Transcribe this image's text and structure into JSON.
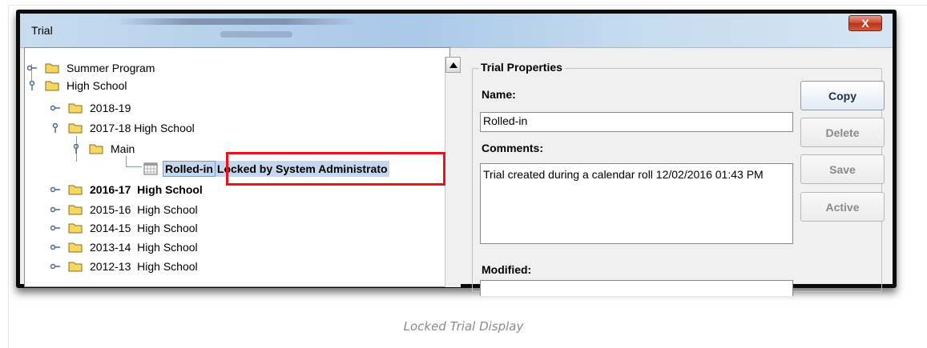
{
  "window": {
    "title": "Trial",
    "close_label": "X"
  },
  "tree": {
    "items": [
      {
        "label": "Summer Program",
        "level": 0,
        "expanded": false
      },
      {
        "label": "High School",
        "level": 0,
        "expanded": true
      },
      {
        "label": "2018-19",
        "level": 1,
        "expanded": false
      },
      {
        "label": "2017-18 High School",
        "level": 1,
        "expanded": true
      },
      {
        "label": "Main",
        "level": 2,
        "expanded": true
      },
      {
        "label": "2016-17  High School",
        "level": 1,
        "expanded": false,
        "bold": true
      },
      {
        "label": "2015-16  High School",
        "level": 1,
        "expanded": false
      },
      {
        "label": "2014-15  High School",
        "level": 1,
        "expanded": false
      },
      {
        "label": "2013-14  High School",
        "level": 1,
        "expanded": false
      },
      {
        "label": "2012-13  High School",
        "level": 1,
        "expanded": false
      }
    ],
    "selected": {
      "label": "Rolled-in",
      "lock_text": "Locked by System Administrato"
    }
  },
  "properties": {
    "legend": "Trial Properties",
    "name_label": "Name:",
    "name_value": "Rolled-in",
    "comments_label": "Comments:",
    "comments_value": "Trial created during a calendar roll 12/02/2016 01:43 PM",
    "modified_label": "Modified:"
  },
  "buttons": {
    "copy": "Copy",
    "delete": "Delete",
    "save": "Save",
    "active": "Active"
  },
  "caption": "Locked Trial Display",
  "colors": {
    "highlight": "#e8141a",
    "selection": "#c6d6ec",
    "folder": "#f5d763"
  }
}
